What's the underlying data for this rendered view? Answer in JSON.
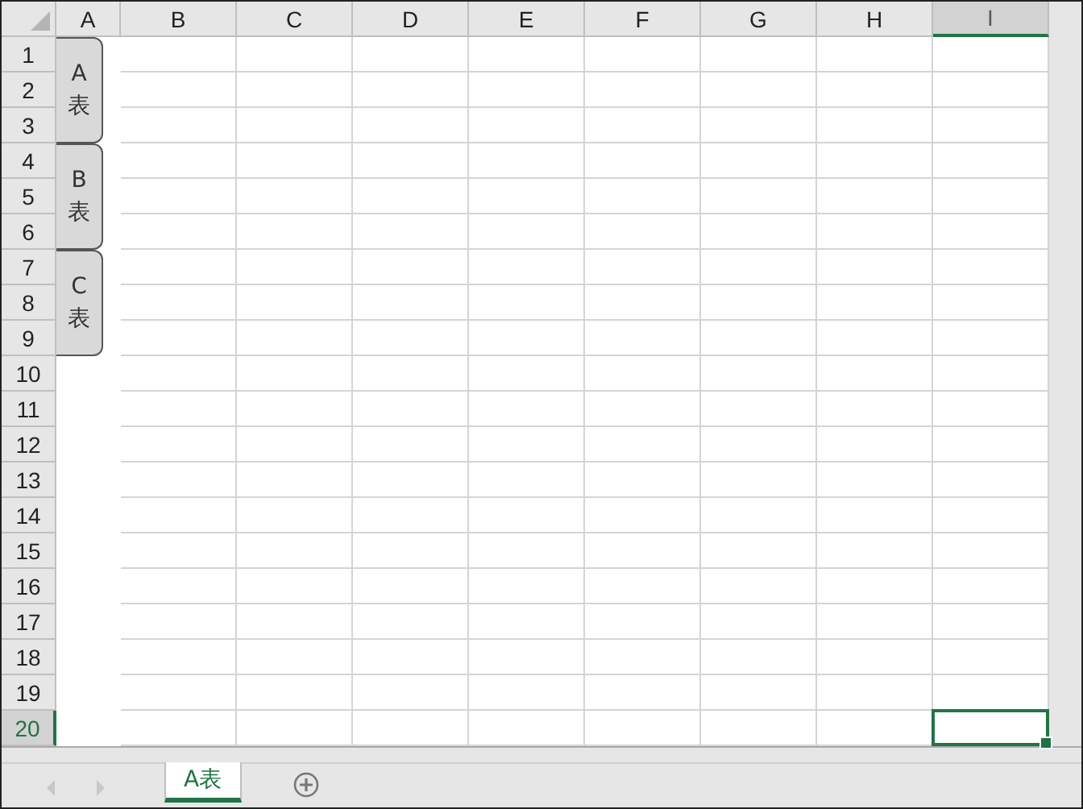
{
  "columns": [
    {
      "label": "A",
      "selected": false
    },
    {
      "label": "B",
      "selected": false
    },
    {
      "label": "C",
      "selected": false
    },
    {
      "label": "D",
      "selected": false
    },
    {
      "label": "E",
      "selected": false
    },
    {
      "label": "F",
      "selected": false
    },
    {
      "label": "G",
      "selected": false
    },
    {
      "label": "H",
      "selected": false
    },
    {
      "label": "I",
      "selected": true
    }
  ],
  "rows": [
    {
      "label": "1",
      "selected": false
    },
    {
      "label": "2",
      "selected": false
    },
    {
      "label": "3",
      "selected": false
    },
    {
      "label": "4",
      "selected": false
    },
    {
      "label": "5",
      "selected": false
    },
    {
      "label": "6",
      "selected": false
    },
    {
      "label": "7",
      "selected": false
    },
    {
      "label": "8",
      "selected": false
    },
    {
      "label": "9",
      "selected": false
    },
    {
      "label": "10",
      "selected": false
    },
    {
      "label": "11",
      "selected": false
    },
    {
      "label": "12",
      "selected": false
    },
    {
      "label": "13",
      "selected": false
    },
    {
      "label": "14",
      "selected": false
    },
    {
      "label": "15",
      "selected": false
    },
    {
      "label": "16",
      "selected": false
    },
    {
      "label": "17",
      "selected": false
    },
    {
      "label": "18",
      "selected": false
    },
    {
      "label": "19",
      "selected": false
    },
    {
      "label": "20",
      "selected": true
    }
  ],
  "sheet_buttons": [
    {
      "label": "A表"
    },
    {
      "label": "B表"
    },
    {
      "label": "C表"
    }
  ],
  "sheet_tabs": [
    {
      "label": "A表",
      "selected": true
    }
  ]
}
